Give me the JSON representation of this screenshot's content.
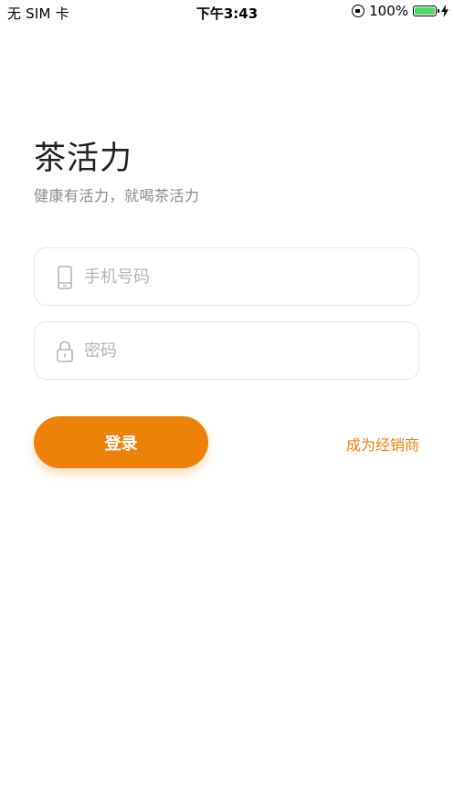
{
  "status_bar": {
    "carrier": "无 SIM 卡",
    "time": "下午3:43",
    "battery_percent": "100%",
    "battery_level": 1.0,
    "icons": [
      "rotation-lock-icon",
      "battery-icon",
      "charging-bolt-icon"
    ]
  },
  "header": {
    "title": "茶活力",
    "subtitle": "健康有活力，就喝茶活力"
  },
  "form": {
    "phone": {
      "placeholder": "手机号码",
      "value": "",
      "icon": "phone-icon"
    },
    "password": {
      "placeholder": "密码",
      "value": "",
      "icon": "lock-icon"
    }
  },
  "actions": {
    "login_label": "登录",
    "dealer_label": "成为经销商"
  },
  "colors": {
    "accent": "#ee8209",
    "placeholder": "#b4b4b4",
    "border": "#e6e6e6",
    "battery": "#4cd964"
  }
}
